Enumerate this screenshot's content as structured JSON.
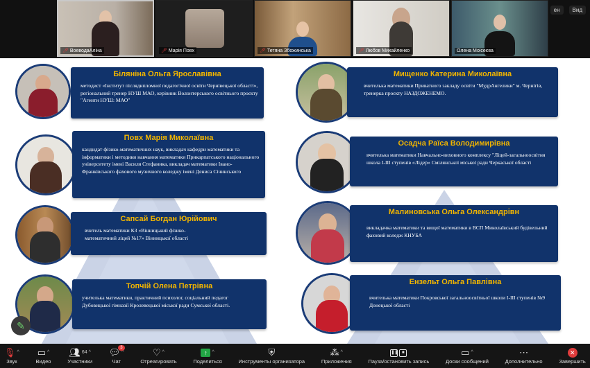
{
  "top_right": {
    "item1": "ен",
    "view_label": "Вид"
  },
  "gallery": [
    {
      "name": "ВоеводаАліна",
      "muted": true
    },
    {
      "name": "Марія Повх",
      "muted": true
    },
    {
      "name": "Тетяна Збожинська",
      "muted": true
    },
    {
      "name": "Любов Михайленко",
      "muted": true
    },
    {
      "name": "Олена Моісеєва",
      "muted": false
    }
  ],
  "cards": [
    {
      "name": "Біляніна Ольга Ярославівна",
      "desc": "методист «Інститут післядипломної педагогічної освіти Чернівецької області», регіональний тренер НУШ МАО, керівник Волонтерського освітнього проєкту \"Агенти НУШ: МАО\""
    },
    {
      "name": "Повх Марія Миколаївна",
      "desc": "кандидат фізико-математичних наук, викладач кафедри математики та інформатики і методики навчання математики Прикарпатського національного університету імені Василя Стефаника, викладач математики Івано-Франківського фахового музичного коледжу імені Дениса Січинського"
    },
    {
      "name": "Сапсай Богдан Юрійович",
      "desc": "вчитель математики КЗ «Вінницький фізико-математичний ліцей №17» Вінницької області"
    },
    {
      "name": "Топчій Олена Петрівна",
      "desc": "учителька математики, практичний психолог, соціальний педагог Дубовицької гімназії Кролевецької міської ради Сумської області."
    },
    {
      "name": "Мищенко Катерина Миколаївна",
      "desc": "вчителька математики Приватного закладу освіти \"МудрАнгелики\" м. Чернігів, тренерка проєкту НАЗДОЖЕНЕМО."
    },
    {
      "name": "Осадча Раїса Володимирівна",
      "desc": "вчителька математики Навчально-виховного комплексу \"Ліцей-загальноосвітня школа І-ІІІ ступенів «Лідер» Смілянської міської ради Черкаської області"
    },
    {
      "name": "Малиновська Ольга Олександрівн",
      "desc": "викладачка математики та вищої математики в ВСП Миколаївський будівельний фаховий коледж КНУБА"
    },
    {
      "name": "Ензельт Ольга Павлівна",
      "desc": "вчителька математики Покровської загальноосвітньої школи І-ІІІ ступенів №9 Донецької області"
    }
  ],
  "toolbar": {
    "audio": "Звук",
    "video": "Видео",
    "participants": "Участники",
    "participants_count": "64",
    "chat": "Чат",
    "chat_badge": "3",
    "react": "Отреагировать",
    "share": "Поделиться",
    "host_tools": "Инструменты организатора",
    "apps": "Приложения",
    "pause_recording": "Пауза/остановить запись",
    "whiteboards": "Доски сообщений",
    "more": "Дополнительно",
    "end": "Завершить"
  },
  "colors": {
    "card_bg": "#11336b",
    "name_gold": "#f0b400",
    "end_red": "#e03c3c",
    "share_green": "#22a645"
  }
}
